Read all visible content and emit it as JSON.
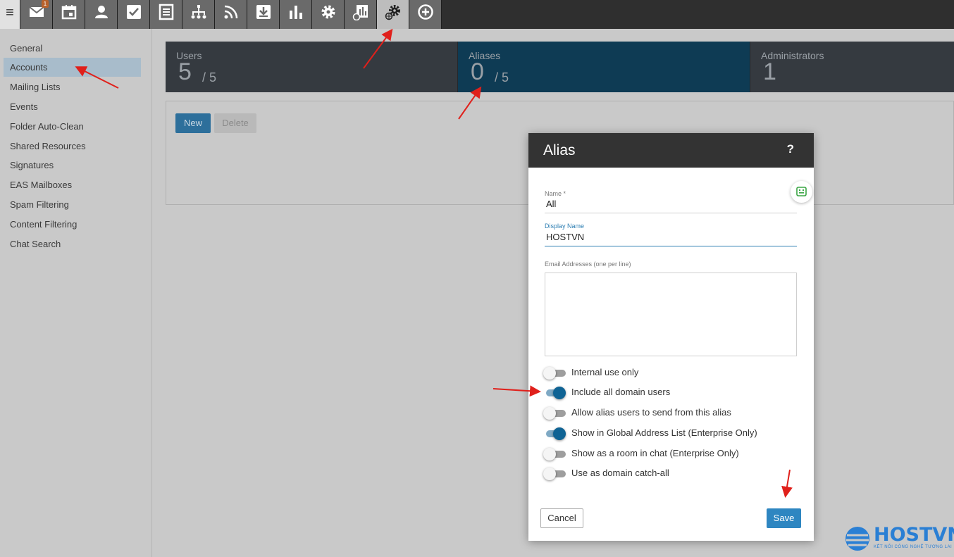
{
  "toolbar": {
    "menu_glyph": "≡",
    "mail_badge": "1",
    "icons": [
      "mail-icon",
      "calendar-icon",
      "contacts-icon",
      "tasks-icon",
      "notes-icon",
      "sitemap-icon",
      "rss-icon",
      "download-icon",
      "reports-icon",
      "settings-icon",
      "domain-report-icon",
      "domain-settings-icon",
      "add-icon"
    ]
  },
  "sidebar": {
    "items": [
      {
        "label": "General"
      },
      {
        "label": "Accounts"
      },
      {
        "label": "Mailing Lists"
      },
      {
        "label": "Events"
      },
      {
        "label": "Folder Auto-Clean"
      },
      {
        "label": "Shared Resources"
      },
      {
        "label": "Signatures"
      },
      {
        "label": "EAS Mailboxes"
      },
      {
        "label": "Spam Filtering"
      },
      {
        "label": "Content Filtering"
      },
      {
        "label": "Chat Search"
      }
    ],
    "selected": "Accounts"
  },
  "stats": {
    "users": {
      "label": "Users",
      "value": "5",
      "limit": "/ 5"
    },
    "aliases": {
      "label": "Aliases",
      "value": "0",
      "limit": "/ 5"
    },
    "administrators": {
      "label": "Administrators",
      "value": "1"
    }
  },
  "actions": {
    "new_label": "New",
    "delete_label": "Delete"
  },
  "modal": {
    "title": "Alias",
    "help": "?",
    "name_label": "Name *",
    "name_value": "All",
    "display_name_label": "Display Name",
    "display_name_value": "HOSTVN",
    "email_label": "Email Addresses (one per line)",
    "email_value": "",
    "toggles": [
      {
        "label": "Internal use only",
        "on": false
      },
      {
        "label": "Include all domain users",
        "on": true
      },
      {
        "label": "Allow alias users to send from this alias",
        "on": false
      },
      {
        "label": "Show in Global Address List (Enterprise Only)",
        "on": true
      },
      {
        "label": "Show as a room in chat (Enterprise Only)",
        "on": false
      },
      {
        "label": "Use as domain catch-all",
        "on": false
      }
    ],
    "cancel_label": "Cancel",
    "save_label": "Save"
  },
  "colors": {
    "accent": "#2e86c1",
    "active_stat": "#0e3b54",
    "toggle_on": "#0f6394",
    "annotation_arrow": "#e0201b"
  },
  "watermark": {
    "brand": "HOSTVN",
    "tagline": "KẾT NỐI CÔNG NGHỆ TƯƠNG LAI"
  }
}
